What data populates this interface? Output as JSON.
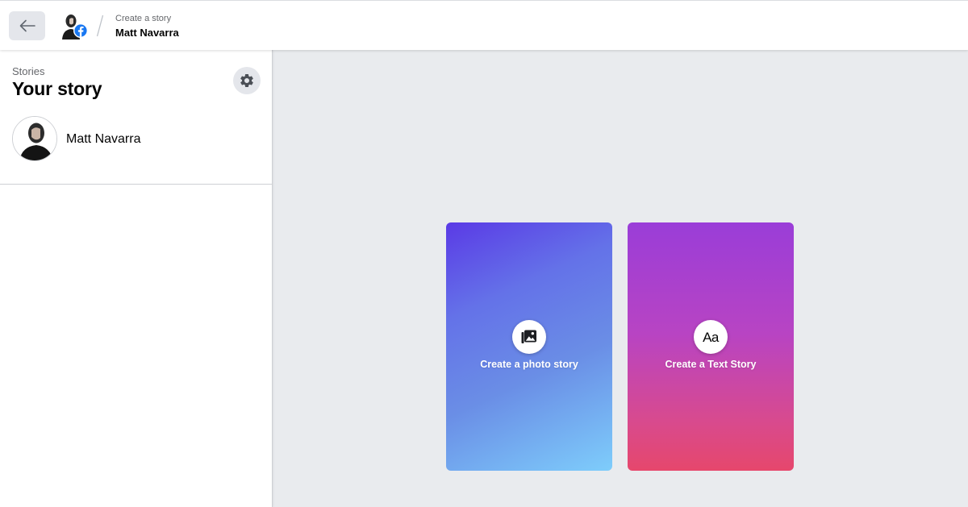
{
  "header": {
    "breadcrumb_sub": "Create a story",
    "breadcrumb_main": "Matt Navarra",
    "back_icon": "arrow-left-icon",
    "facebook_badge_color": "#1877f2"
  },
  "sidebar": {
    "section_label": "Stories",
    "title": "Your story",
    "settings_icon": "gear-icon",
    "user": {
      "name": "Matt Navarra"
    }
  },
  "cards": {
    "photo": {
      "label": "Create a photo story",
      "icon": "photo-icon",
      "gradient_colors": [
        "#5a3ae6",
        "#6a8ee6",
        "#7ecdfb"
      ]
    },
    "text": {
      "label": "Create a Text Story",
      "icon_text": "Aa",
      "icon": "text-aa-icon",
      "gradient_colors": [
        "#9a3dd8",
        "#b844c3",
        "#e6476c"
      ]
    }
  },
  "colors": {
    "main_background": "#e9ebee",
    "button_gray": "#e4e6eb",
    "secondary_text": "#65676b"
  }
}
